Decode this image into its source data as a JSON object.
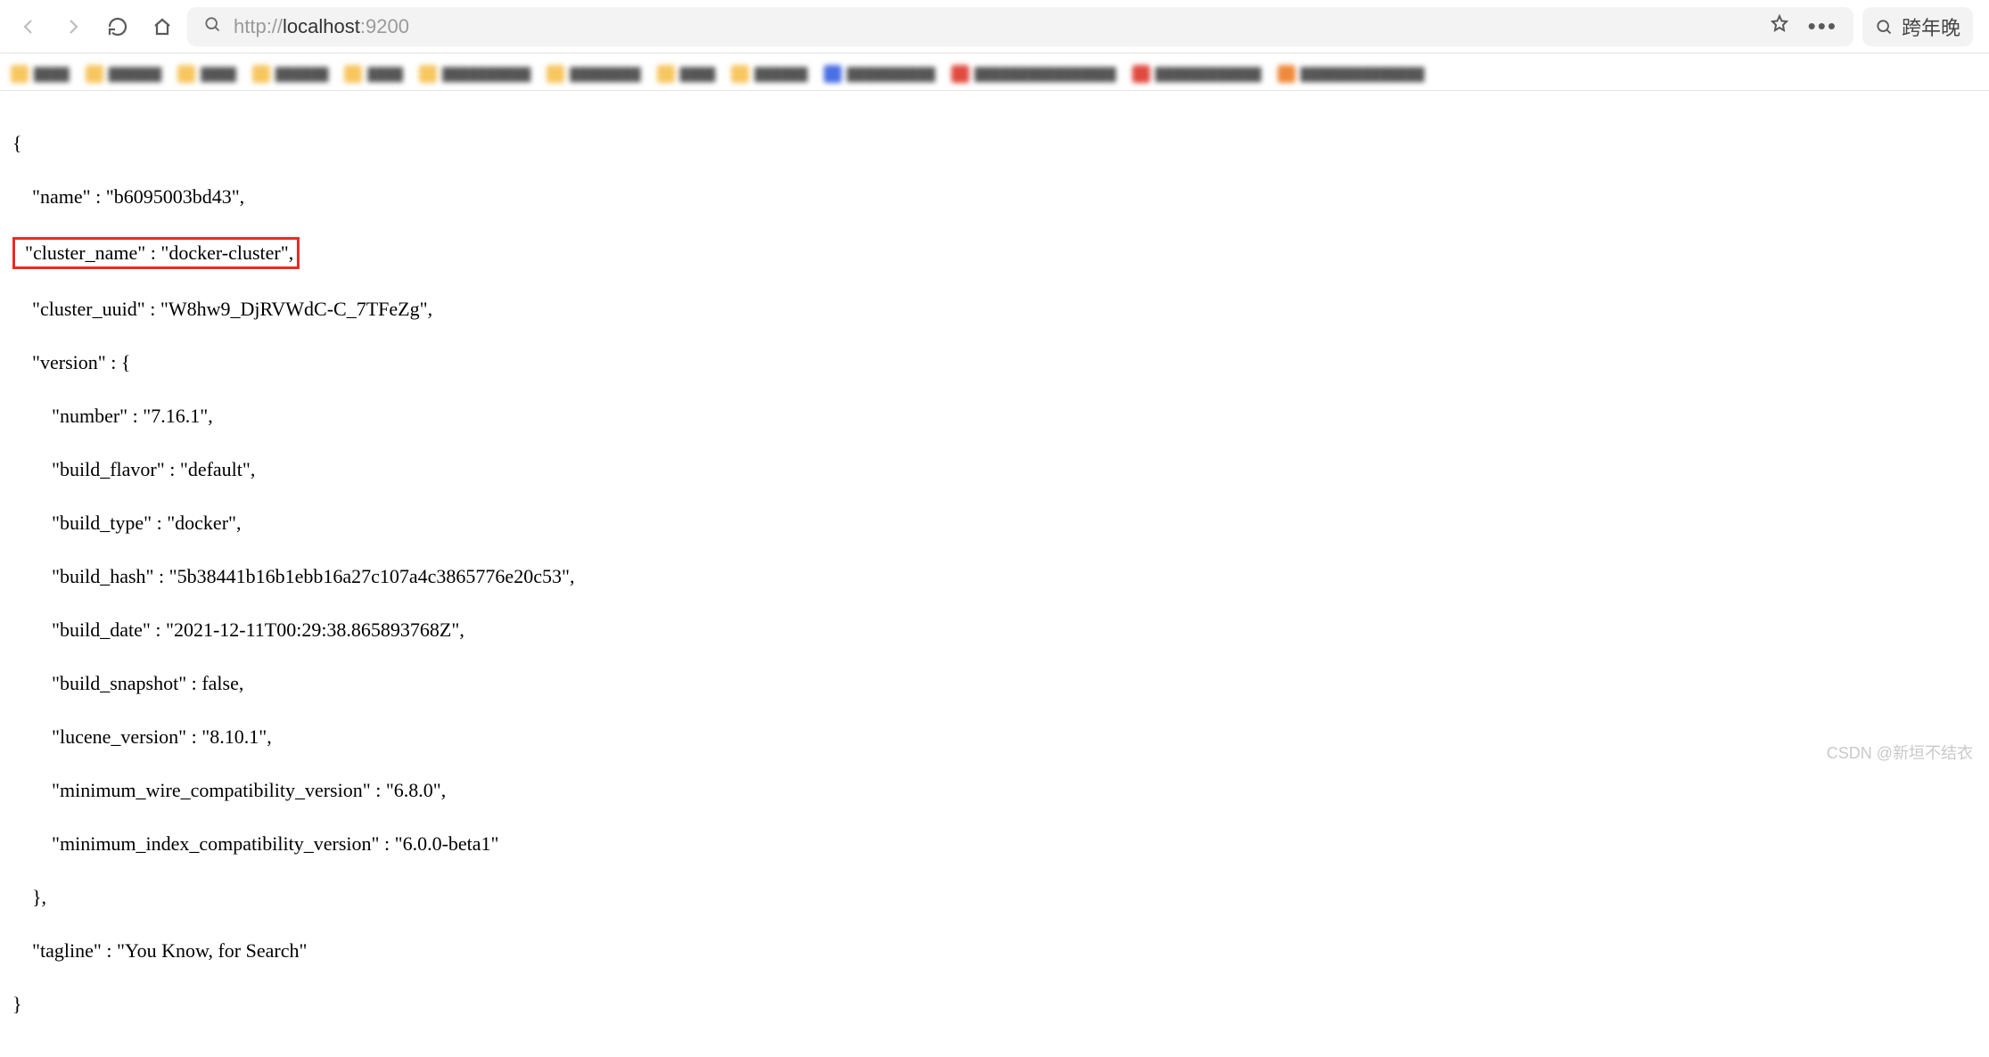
{
  "browser": {
    "url_protocol": "http://",
    "url_host": "localhost",
    "url_port": ":9200",
    "search_hint": "跨年晚"
  },
  "json_response": {
    "name": "b6095003bd43",
    "cluster_name": "docker-cluster",
    "cluster_uuid": "W8hw9_DjRVWdC-C_7TFeZg",
    "version": {
      "number": "7.16.1",
      "build_flavor": "default",
      "build_type": "docker",
      "build_hash": "5b38441b16b1ebb16a27c107a4c3865776e20c53",
      "build_date": "2021-12-11T00:29:38.865893768Z",
      "build_snapshot": "false",
      "lucene_version": "8.10.1",
      "minimum_wire_compatibility_version": "6.8.0",
      "minimum_index_compatibility_version": "6.0.0-beta1"
    },
    "tagline": "You Know, for Search"
  },
  "labels": {
    "name": "\"name\" : ",
    "cluster_name": "\"cluster_name\" : ",
    "cluster_uuid": "\"cluster_uuid\" : ",
    "version": "\"version\" : {",
    "number": "\"number\" : ",
    "build_flavor": "\"build_flavor\" : ",
    "build_type": "\"build_type\" : ",
    "build_hash": "\"build_hash\" : ",
    "build_date": "\"build_date\" : ",
    "build_snapshot": "\"build_snapshot\" : ",
    "lucene_version": "\"lucene_version\" : ",
    "min_wire": "\"minimum_wire_compatibility_version\" : ",
    "min_index": "\"minimum_index_compatibility_version\" : ",
    "tagline": "\"tagline\" : "
  },
  "watermark": "CSDN @新垣不结衣"
}
